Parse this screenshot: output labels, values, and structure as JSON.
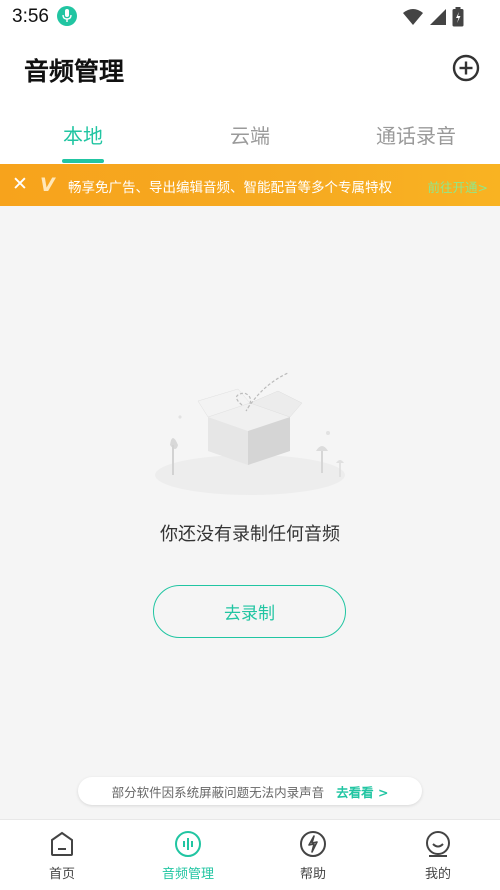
{
  "status_bar": {
    "time": "3:56"
  },
  "header": {
    "title": "音频管理"
  },
  "tabs": [
    {
      "label": "本地",
      "active": true
    },
    {
      "label": "云端",
      "active": false
    },
    {
      "label": "通话录音",
      "active": false
    }
  ],
  "vip_banner": {
    "close": "✕",
    "logo": "V",
    "text": "畅享免广告、导出编辑音频、智能配音等多个专属特权",
    "link": "前往开通>"
  },
  "empty_state": {
    "message": "你还没有录制任何音频",
    "button": "去录制"
  },
  "hint": {
    "text": "部分软件因系统屏蔽问题无法内录声音",
    "link": "去看看 >"
  },
  "bottom_nav": [
    {
      "label": "首页",
      "icon": "home-icon",
      "active": false
    },
    {
      "label": "音频管理",
      "icon": "audio-wave-icon",
      "active": true
    },
    {
      "label": "帮助",
      "icon": "help-icon",
      "active": false
    },
    {
      "label": "我的",
      "icon": "profile-icon",
      "active": false
    }
  ],
  "colors": {
    "accent": "#21c5a2",
    "vip_banner": "#f7a31c"
  }
}
